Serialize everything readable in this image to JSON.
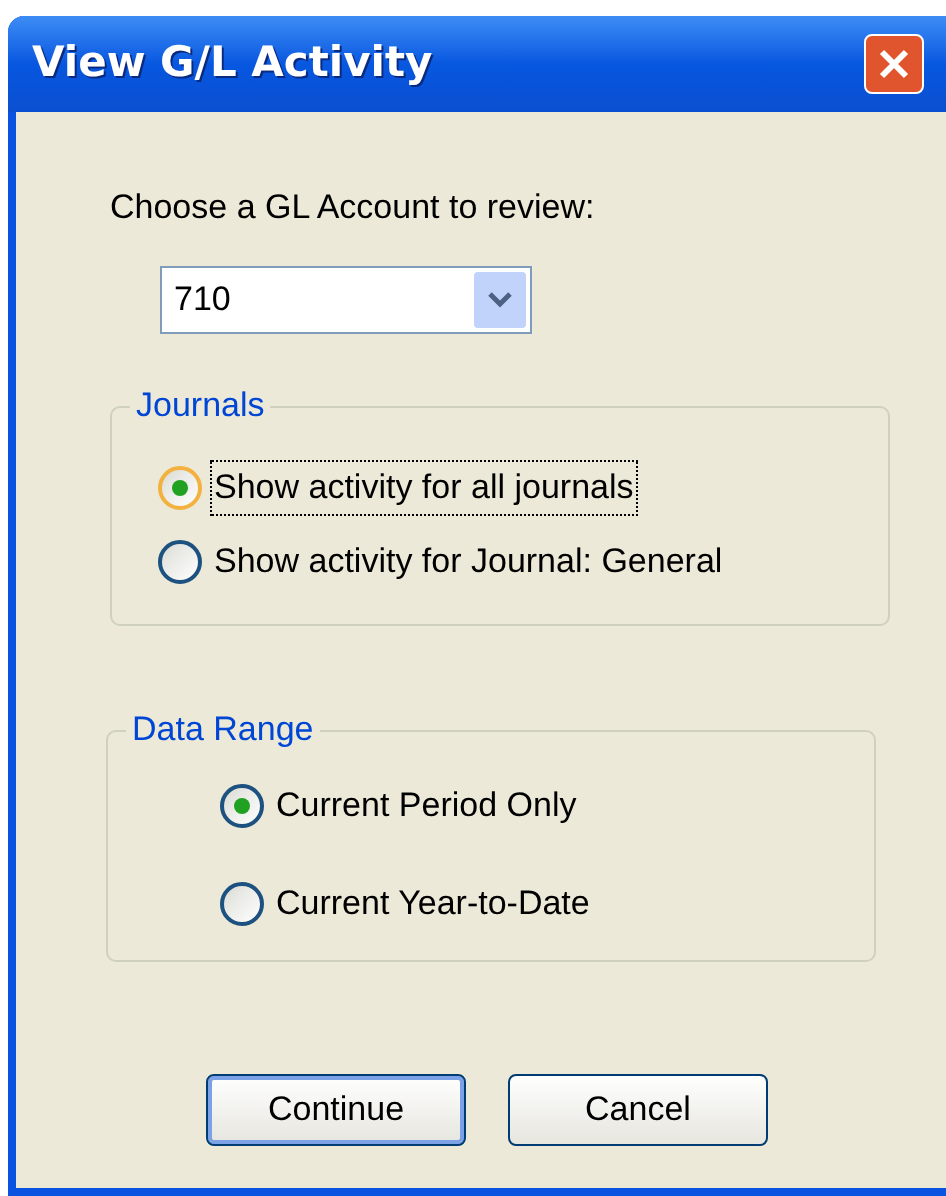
{
  "window": {
    "title": "View G/L Activity"
  },
  "account": {
    "label": "Choose a GL Account to review:",
    "value": "710"
  },
  "groups": [
    {
      "title": "Journals",
      "options": [
        {
          "label": "Show activity for all journals",
          "selected": true,
          "focused": true
        },
        {
          "label": "Show activity for Journal: General",
          "selected": false,
          "focused": false
        }
      ]
    },
    {
      "title": "Data Range",
      "options": [
        {
          "label": "Current Period Only",
          "selected": true,
          "focused": false
        },
        {
          "label": "Current Year-to-Date",
          "selected": false,
          "focused": false
        }
      ]
    }
  ],
  "buttons": [
    {
      "label": "Continue",
      "default": true
    },
    {
      "label": "Cancel",
      "default": false
    }
  ]
}
